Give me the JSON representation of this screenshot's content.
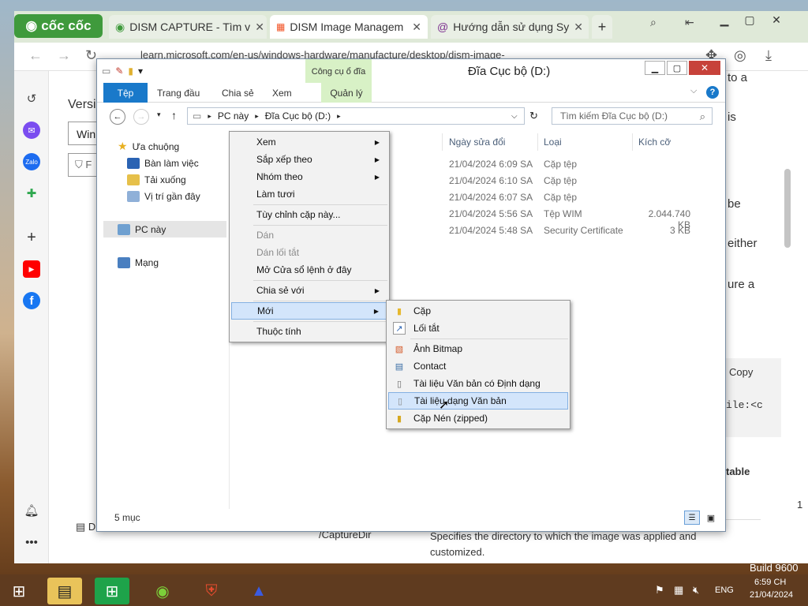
{
  "browser": {
    "logo_text": "cốc cốc",
    "tabs": [
      {
        "title": "DISM CAPTURE - Tìm v"
      },
      {
        "title": "DISM Image Managem"
      },
      {
        "title": "Hướng dẫn sử dụng Sy"
      }
    ],
    "url": "learn.microsoft.com/en-us/windows-hardware/manufacture/desktop/dism-image-"
  },
  "page": {
    "version_label": "Versi",
    "select_value": "Win",
    "filter_text": "F",
    "right_frags": [
      "to a",
      "is",
      "be",
      "either",
      "ure a"
    ],
    "copy_label": "Copy",
    "code_frag": "ile:<c",
    "table_frag": "table",
    "param_name": "/CaptureDir",
    "param_desc": "Specifies the directory to which the image was applied and customized.",
    "left_frag": "D",
    "num_frag": "1",
    "build_text": "Build 9600"
  },
  "explorer": {
    "title": "Đĩa Cục bộ (D:)",
    "context_tool_tab": "Công cụ ổ đĩa",
    "ribbon_tabs": [
      "Tệp",
      "Trang đầu",
      "Chia sẻ",
      "Xem",
      "Quản lý"
    ],
    "breadcrumb": [
      "PC này",
      "Đĩa Cục bộ (D:)"
    ],
    "search_placeholder": "Tìm kiếm Đĩa Cục bộ (D:)",
    "nav": {
      "favorites": "Ưa chuộng",
      "desktop": "Bàn làm việc",
      "downloads": "Tải xuống",
      "recent": "Vị trí gần đây",
      "this_pc": "PC này",
      "network": "Mạng"
    },
    "columns": {
      "date": "Ngày sửa đổi",
      "type": "Loại",
      "size": "Kích cỡ"
    },
    "files": [
      {
        "date": "21/04/2024 6:09 SA",
        "type": "Cặp tệp",
        "size": ""
      },
      {
        "date": "21/04/2024 6:10 SA",
        "type": "Cặp tệp",
        "size": ""
      },
      {
        "date": "21/04/2024 6:07 SA",
        "type": "Cặp tệp",
        "size": ""
      },
      {
        "date": "21/04/2024 5:56 SA",
        "type": "Tệp WIM",
        "size": "2.044.740 KB"
      },
      {
        "date": "21/04/2024 5:48 SA",
        "type": "Security Certificate",
        "size": "3 KB"
      }
    ],
    "status": "5 mục"
  },
  "context_menu": {
    "items": [
      {
        "label": "Xem",
        "submenu": true,
        "disabled": false
      },
      {
        "label": "Sắp xếp theo",
        "submenu": true,
        "disabled": false
      },
      {
        "label": "Nhóm theo",
        "submenu": true,
        "disabled": false
      },
      {
        "label": "Làm tươi",
        "submenu": false,
        "disabled": false
      },
      {
        "label": "Tùy chỉnh cặp này...",
        "submenu": false,
        "disabled": false
      },
      {
        "label": "Dán",
        "submenu": false,
        "disabled": true
      },
      {
        "label": "Dán lối tắt",
        "submenu": false,
        "disabled": true
      },
      {
        "label": "Mở Cửa sổ lệnh ở đây",
        "submenu": false,
        "disabled": false
      },
      {
        "label": "Chia sẻ với",
        "submenu": true,
        "disabled": false
      },
      {
        "label": "Mới",
        "submenu": true,
        "disabled": false
      },
      {
        "label": "Thuộc tính",
        "submenu": false,
        "disabled": false
      }
    ]
  },
  "new_submenu": {
    "items": [
      {
        "label": "Cặp",
        "icon": "folder-icon"
      },
      {
        "label": "Lối tắt",
        "icon": "shortcut-icon"
      },
      {
        "label": "Ảnh Bitmap",
        "icon": "bitmap-icon"
      },
      {
        "label": "Contact",
        "icon": "contact-icon"
      },
      {
        "label": "Tài liệu Văn bản có Định dạng",
        "icon": "rtf-document-icon"
      },
      {
        "label": "Tài liệu dạng Văn bản",
        "icon": "text-document-icon"
      },
      {
        "label": "Cặp Nén (zipped)",
        "icon": "zip-folder-icon"
      }
    ]
  },
  "tray": {
    "language": "ENG",
    "time": "6:59 CH",
    "date": "21/04/2024"
  },
  "colors": {
    "accent_blue": "#1979ca",
    "ribbon_context_green": "#d8f1c6",
    "browser_tabbar": "#dfe9d8",
    "coccoc_green": "#3f9a3c",
    "highlight": "#d3e5fb"
  }
}
